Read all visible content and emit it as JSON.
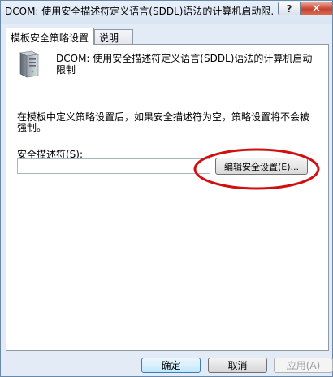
{
  "window": {
    "title": "DCOM: 使用安全描述符定义语言(SDDL)语法的计算机启动限...",
    "help_label": "?",
    "close_label": "✕"
  },
  "tabs": [
    {
      "label": "模板安全策略设置",
      "active": true
    },
    {
      "label": "说明",
      "active": false
    }
  ],
  "policy": {
    "icon": "server-computer-icon",
    "title": "DCOM: 使用安全描述符定义语言(SDDL)语法的计算机启动限制"
  },
  "description": "在模板中定义策略设置后，如果安全描述符为空，策略设置将不会被强制。",
  "security_descriptor": {
    "label": "安全描述符(S):",
    "value": ""
  },
  "edit_button_label": "编辑安全设置(E)...",
  "annotation_color": "#d01010",
  "buttons": {
    "ok": "确定",
    "cancel": "取消",
    "apply": "应用(A)"
  }
}
